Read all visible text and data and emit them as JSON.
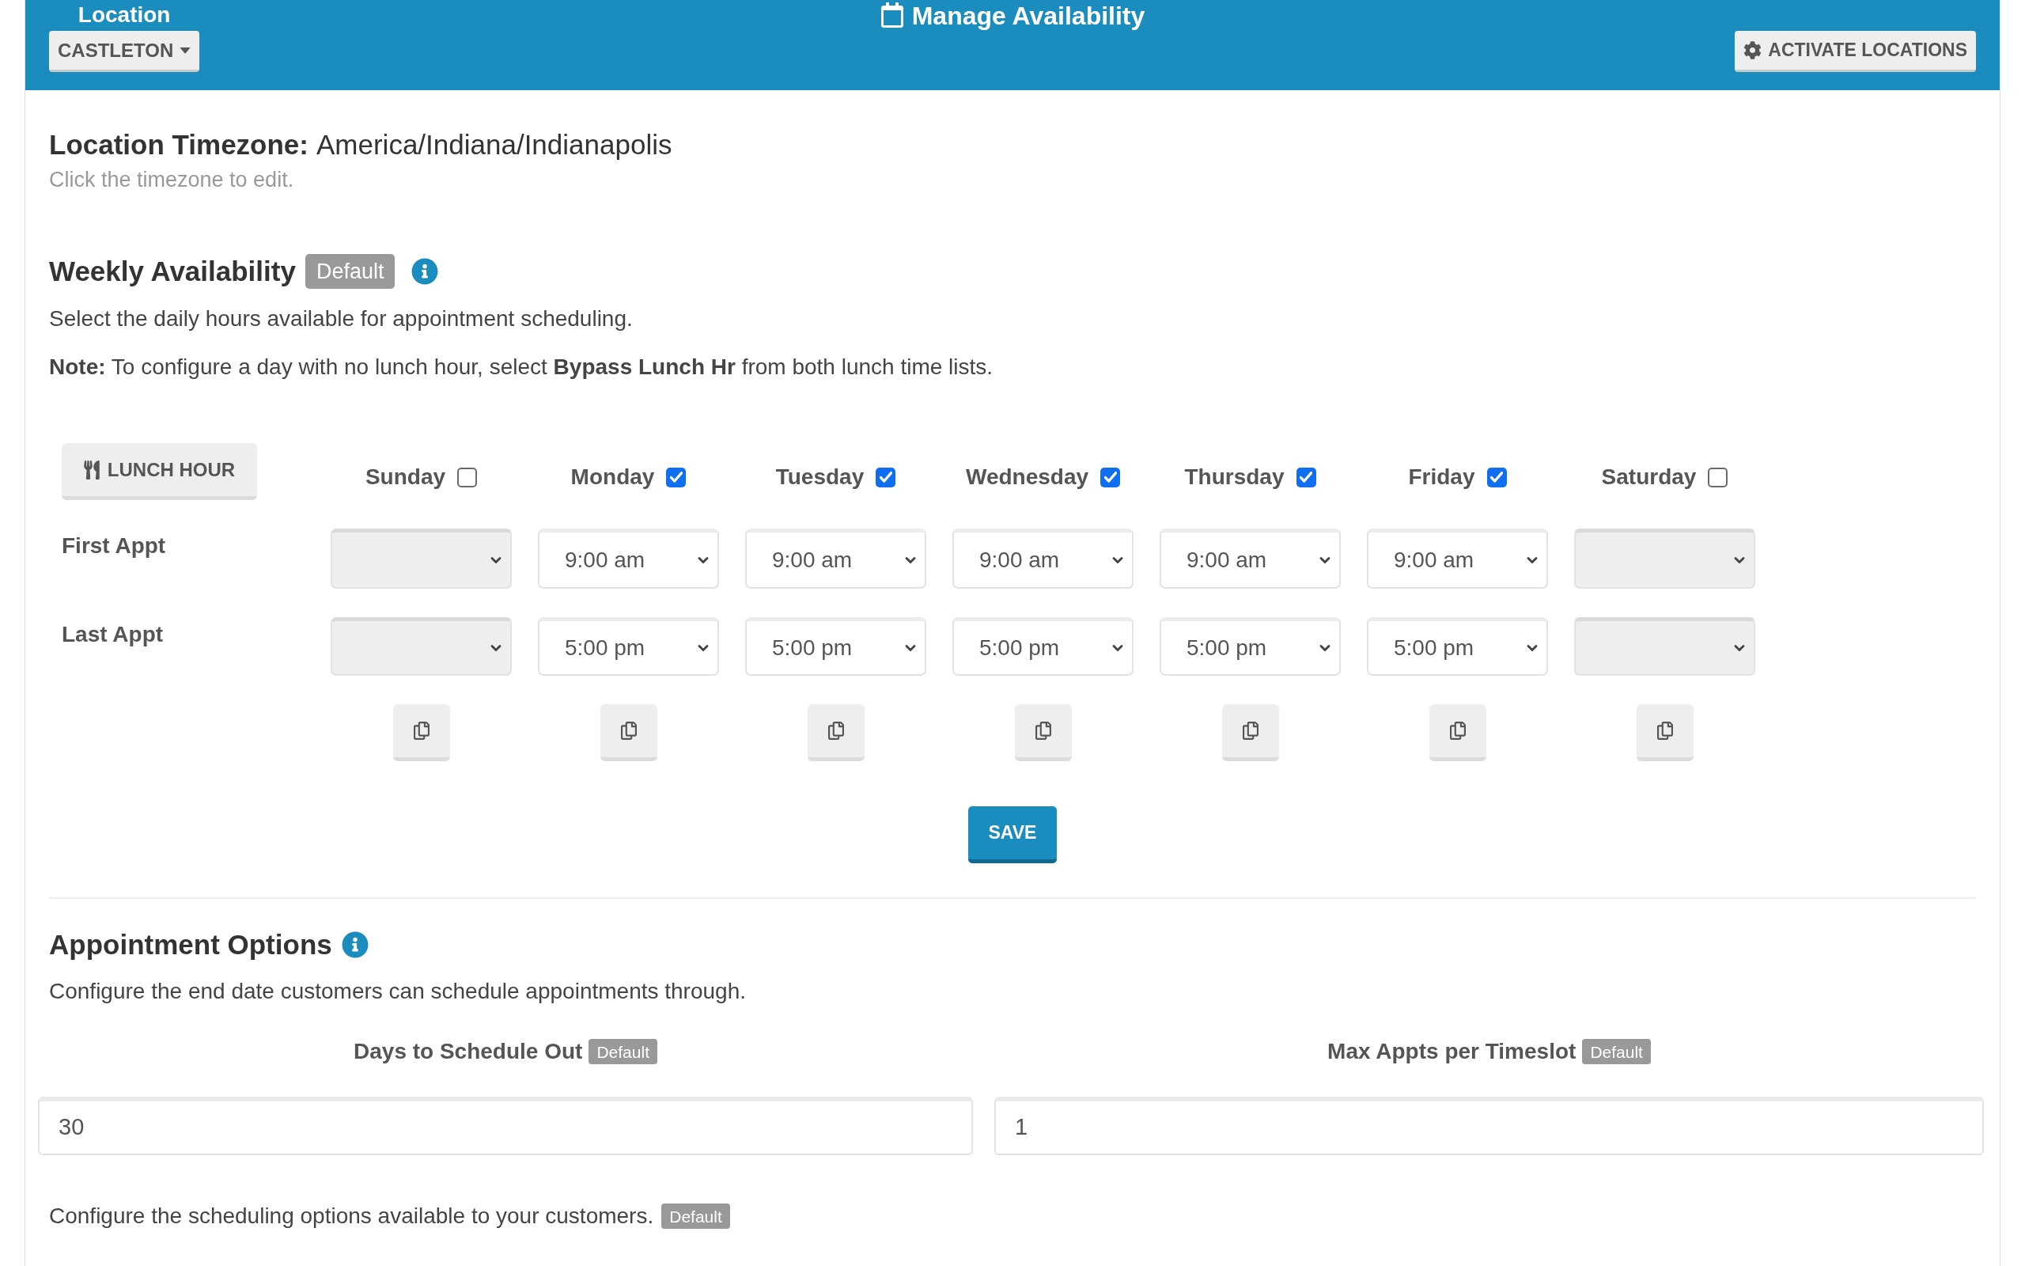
{
  "header": {
    "location_label": "Location",
    "location_button": "CASTLETON",
    "title": "Manage Availability",
    "activate_button": "ACTIVATE LOCATIONS"
  },
  "timezone": {
    "label": "Location Timezone:",
    "value": "America/Indiana/Indianapolis",
    "hint": "Click the timezone to edit."
  },
  "weekly_availability": {
    "title": "Weekly Availability",
    "badge": "Default",
    "description": "Select the daily hours available for appointment scheduling.",
    "note": "**Note:** To configure a day with no lunch hour, select **Bypass Lunch Hr** from both lunch time lists.",
    "lunch_hour_button": "LUNCH HOUR",
    "row_labels": [
      "First Appt",
      "Last Appt"
    ],
    "days": [
      {
        "name": "Sunday",
        "checked": false,
        "first_appt": {
          "disabled": true
        },
        "last_appt": {
          "disabled": true
        }
      },
      {
        "name": "Monday",
        "checked": true,
        "first_appt": {
          "value": "9:00 am",
          "disabled": false
        },
        "last_appt": {
          "value": "5:00 pm",
          "disabled": false
        }
      },
      {
        "name": "Tuesday",
        "checked": true,
        "first_appt": {
          "value": "9:00 am",
          "disabled": false
        },
        "last_appt": {
          "value": "5:00 pm",
          "disabled": false
        }
      },
      {
        "name": "Wednesday",
        "checked": true,
        "first_appt": {
          "value": "9:00 am",
          "disabled": false
        },
        "last_appt": {
          "value": "5:00 pm",
          "disabled": false
        }
      },
      {
        "name": "Thursday",
        "checked": true,
        "first_appt": {
          "value": "9:00 am",
          "disabled": false
        },
        "last_appt": {
          "value": "5:00 pm",
          "disabled": false
        }
      },
      {
        "name": "Friday",
        "checked": true,
        "first_appt": {
          "value": "9:00 am",
          "disabled": false
        },
        "last_appt": {
          "value": "5:00 pm",
          "disabled": false
        }
      },
      {
        "name": "Saturday",
        "checked": false,
        "first_appt": {
          "disabled": true
        },
        "last_appt": {
          "disabled": true
        }
      }
    ],
    "save_button": "SAVE"
  },
  "appointment_options": {
    "title": "Appointment Options",
    "description": "Configure the end date customers can schedule appointments through.",
    "fields": [
      {
        "label": "Days to Schedule Out",
        "badge": "Default",
        "value": "30"
      },
      {
        "label": "Max Appts per Timeslot",
        "badge": "Default",
        "value": "1"
      }
    ],
    "scheduling_note": {
      "text": "Configure the scheduling options available to your customers.",
      "badge": "Default"
    }
  }
}
